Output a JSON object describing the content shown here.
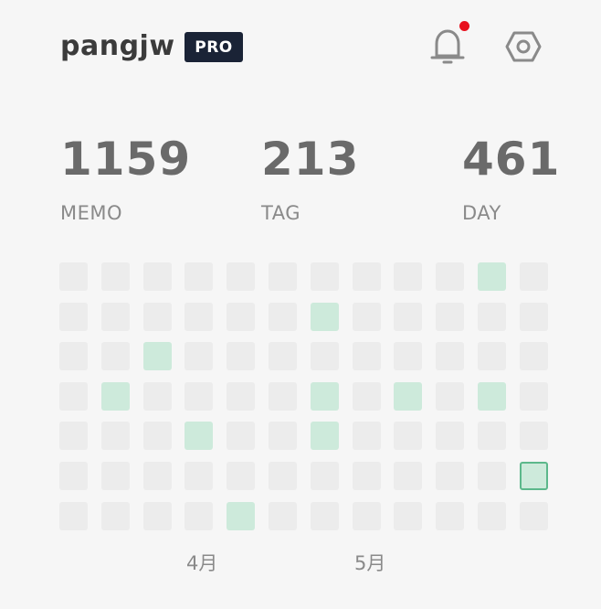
{
  "header": {
    "username": "pangjw",
    "badge": "PRO",
    "has_unread_notifications": true
  },
  "stats": {
    "memo": {
      "value": "1159",
      "label": "MEMO"
    },
    "tag": {
      "value": "213",
      "label": "TAG"
    },
    "day": {
      "value": "461",
      "label": "DAY"
    }
  },
  "heatmap": {
    "columns": 12,
    "rows": 7,
    "colors": {
      "empty": "#ececec",
      "active": "#cdeadb",
      "today_border": "#5cb88b"
    },
    "active_cells": [
      {
        "col": 10,
        "row": 0
      },
      {
        "col": 6,
        "row": 1
      },
      {
        "col": 2,
        "row": 2
      },
      {
        "col": 1,
        "row": 3
      },
      {
        "col": 6,
        "row": 3
      },
      {
        "col": 8,
        "row": 3
      },
      {
        "col": 10,
        "row": 3
      },
      {
        "col": 3,
        "row": 4
      },
      {
        "col": 6,
        "row": 4
      },
      {
        "col": 4,
        "row": 6
      }
    ],
    "today_cell": {
      "col": 11,
      "row": 5
    },
    "month_labels": [
      {
        "label": "4月",
        "col": 3
      },
      {
        "label": "5月",
        "col": 7
      }
    ]
  },
  "icons": {
    "notifications": "bell-icon",
    "settings": "gear-icon"
  }
}
